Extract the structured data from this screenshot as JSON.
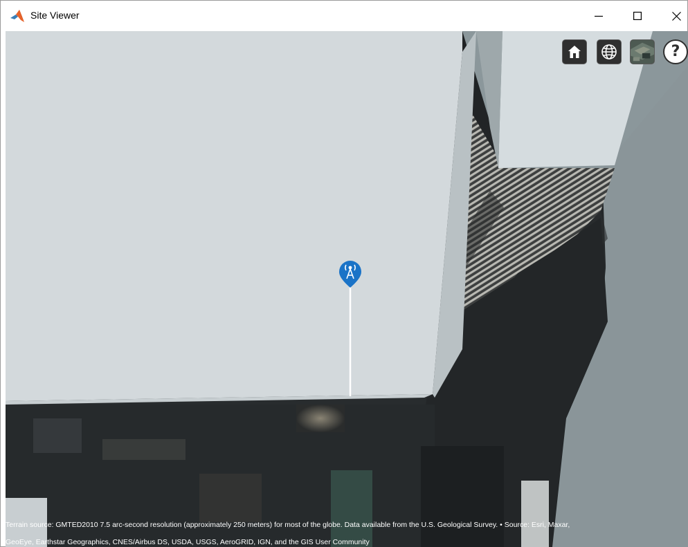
{
  "window": {
    "title": "Site Viewer",
    "controls": {
      "minimize": "minimize",
      "maximize": "maximize",
      "close": "close"
    }
  },
  "toolbar": {
    "home_icon": "home-icon",
    "globe_icon": "globe-icon",
    "imagery_icon": "basemap-imagery-icon",
    "help_label": "?"
  },
  "map": {
    "site_marker_icon": "antenna-tower-icon",
    "accent_color": "#1a73c7"
  },
  "attribution": {
    "line1": "Terrain source: GMTED2010 7.5 arc-second resolution (approximately 250 meters) for most of the globe. Data available from the U.S. Geological Survey. • Source: Esri, Maxar,",
    "line2": "GeoEye, Earthstar Geographics, CNES/Airbus DS, USDA, USGS, AeroGRID, IGN, and the GIS User Community"
  }
}
